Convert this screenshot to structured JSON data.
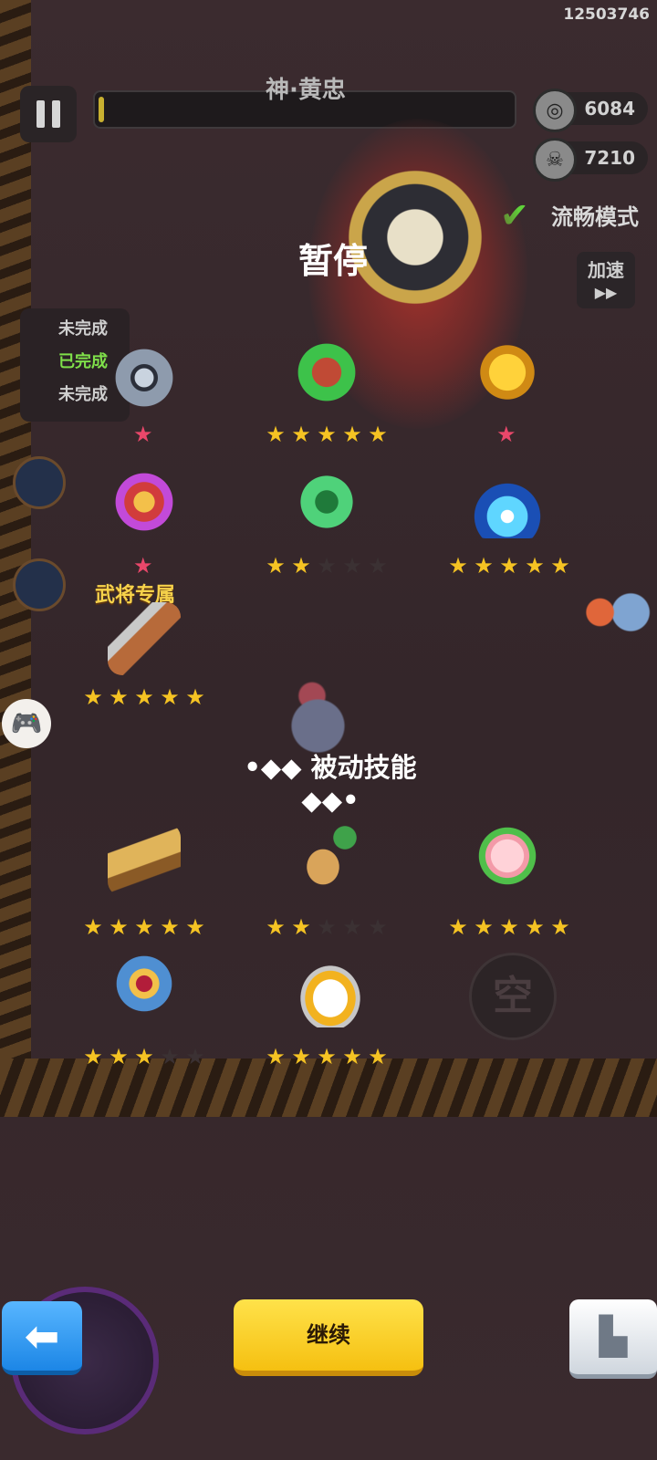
{
  "top_id": "12503746",
  "boss": {
    "name": "神·黄忠",
    "health_fraction": 0.01
  },
  "counters": {
    "coins": "6084",
    "kills": "7210"
  },
  "toggles": {
    "smooth_mode_label": "流畅模式",
    "smooth_mode_checked": true,
    "speed_label": "加速",
    "speed_arrow": "▶▶"
  },
  "pause_title": "暂停",
  "tasks": [
    "未完成",
    "已完成",
    "未完成"
  ],
  "active_skills": [
    {
      "name": "shuriken-icon",
      "stars": null,
      "pink_star": true
    },
    {
      "name": "jade-tower-icon",
      "stars": 5,
      "pink_star": false
    },
    {
      "name": "golden-gauntlet-icon",
      "stars": null,
      "pink_star": true
    },
    {
      "name": "phoenix-fan-icon",
      "stars": null,
      "pink_star": true
    },
    {
      "name": "wind-tornado-icon",
      "stars": 2,
      "pink_star": false
    },
    {
      "name": "lightning-icon",
      "stars": 5,
      "pink_star": false
    },
    {
      "name": "crossbow-icon",
      "stars": 5,
      "pink_star": false
    }
  ],
  "exclusive_label": "武将专属",
  "passive_title": "被动技能",
  "passive_skills": [
    {
      "name": "book-icon",
      "stars": 5
    },
    {
      "name": "ginseng-icon",
      "stars": 2
    },
    {
      "name": "peach-icon",
      "stars": 5
    },
    {
      "name": "armor-icon",
      "stars": 3
    },
    {
      "name": "boots-icon",
      "stars": 5
    }
  ],
  "empty_slot_label": "空",
  "buttons": {
    "continue": "继续",
    "back_arrow": "⬅",
    "rank_icon": "▙"
  },
  "glyphs": {
    "star": "★",
    "pink_star": "★",
    "check": "✔",
    "skull": "☠",
    "coin": "◎",
    "gamepad": "🎮"
  },
  "colors": {
    "star_on": "#f5c323",
    "star_off": "#3b3133",
    "continue_button": "#f5c011",
    "back_button": "#1c86e6"
  }
}
